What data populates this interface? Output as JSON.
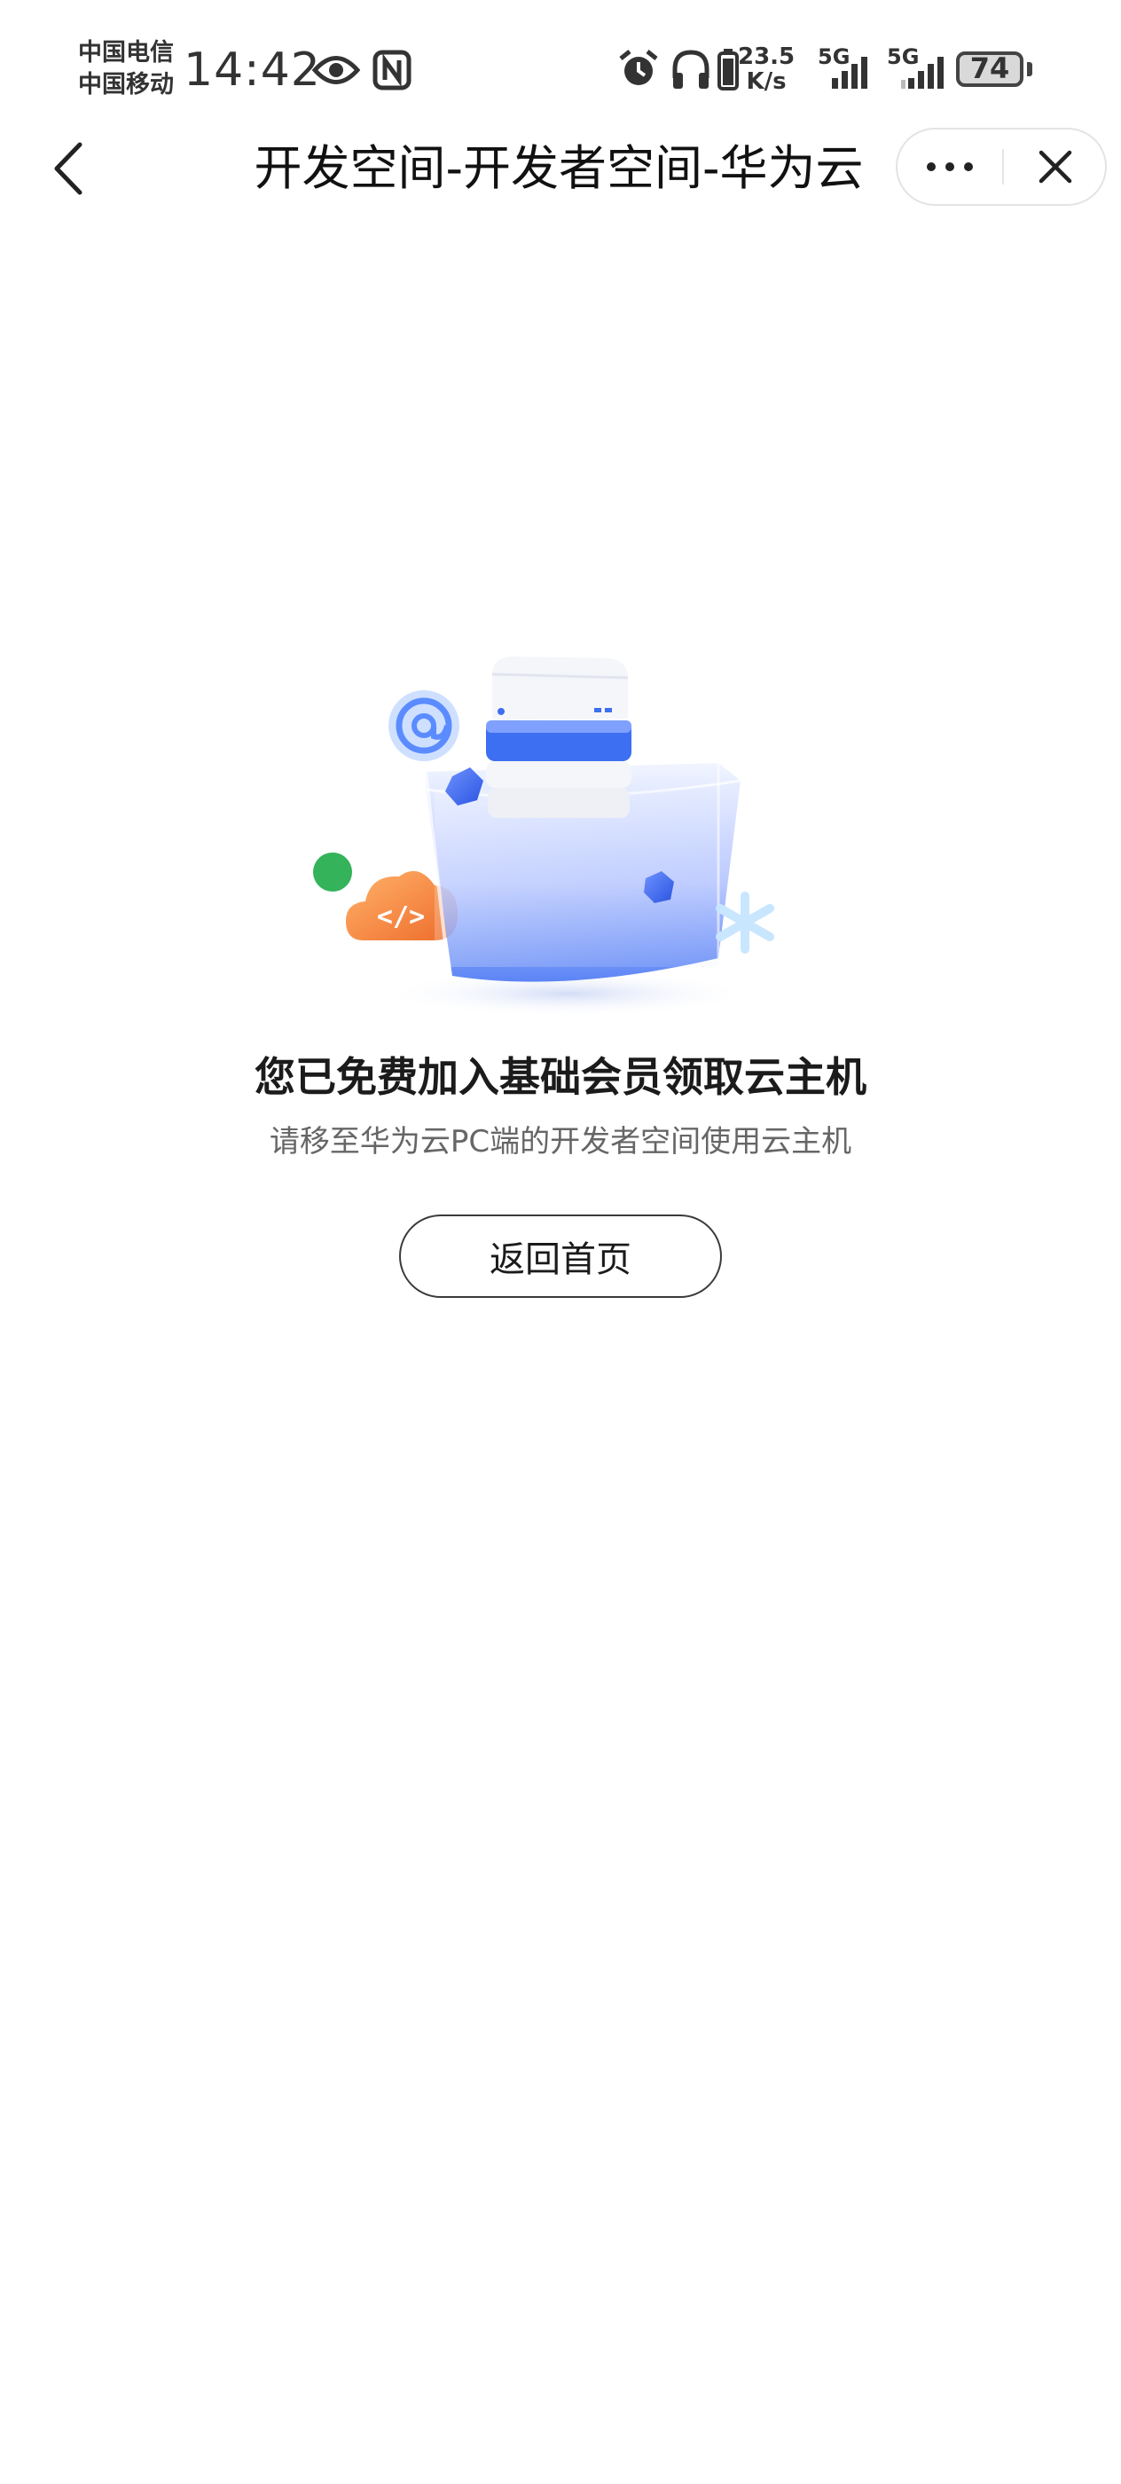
{
  "status_bar": {
    "carrier_1": "中国电信",
    "carrier_2": "中国移动",
    "time": "14:42",
    "network_speed_value": "23.5",
    "network_speed_unit": "K/s",
    "signal_1_label": "5G",
    "signal_2_label": "5G",
    "battery_level": "74",
    "icons": [
      "eye-icon",
      "nfc-icon",
      "alarm-icon",
      "headphones-icon",
      "battery-saver-icon",
      "signal-icon",
      "signal-icon",
      "battery-icon"
    ]
  },
  "nav": {
    "title": "开发空间-开发者空间-华为云",
    "icons": [
      "back-arrow-icon",
      "more-dots-icon",
      "close-icon"
    ]
  },
  "main": {
    "heading": "您已免费加入基础会员领取云主机",
    "subtext": "请移至华为云PC端的开发者空间使用云主机",
    "home_button_label": "返回首页"
  },
  "colors": {
    "accent_blue": "#3d6ff2",
    "cloud_orange": "#f2853a",
    "dot_green": "#34b35a"
  }
}
